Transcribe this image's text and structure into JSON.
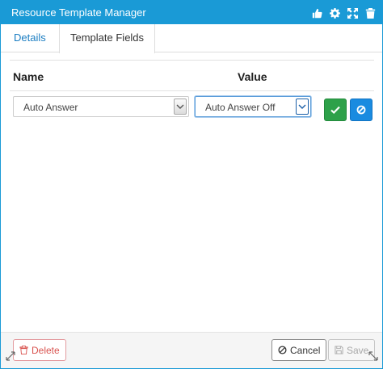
{
  "window": {
    "title": "Resource Template Manager"
  },
  "titlebar_icons": [
    "thumbs-up-icon",
    "gear-icon",
    "expand-icon",
    "trash-icon"
  ],
  "tabs": [
    {
      "label": "Details",
      "active": false
    },
    {
      "label": "Template Fields",
      "active": true
    }
  ],
  "table": {
    "headers": {
      "name": "Name",
      "value": "Value"
    },
    "row": {
      "name": "Auto Answer",
      "value": "Auto Answer Off"
    }
  },
  "footer": {
    "delete_label": "Delete",
    "cancel_label": "Cancel",
    "save_label": "Save"
  },
  "colors": {
    "accent": "#1a9ad6",
    "ok_button": "#2ea14a",
    "row_cancel_button": "#1a8be0",
    "danger": "#d9534f"
  }
}
